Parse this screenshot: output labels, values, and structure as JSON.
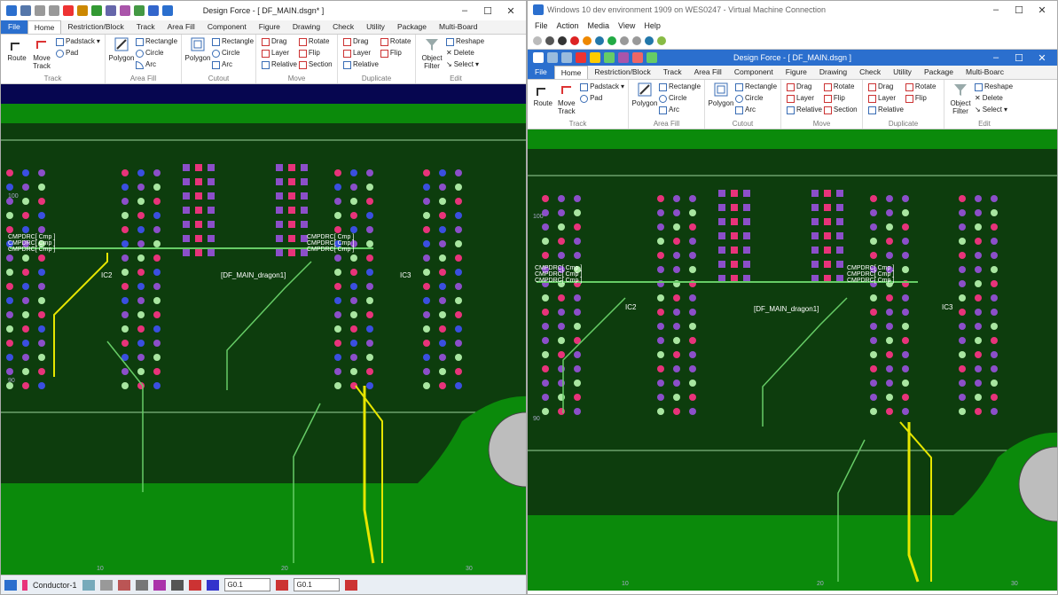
{
  "left_window": {
    "title": "Design Force - [ DF_MAIN.dsgn* ]",
    "tabs": [
      "File",
      "Home",
      "Restriction/Block",
      "Track",
      "Area Fill",
      "Component",
      "Figure",
      "Drawing",
      "Check",
      "Utility",
      "Package",
      "Multi-Board"
    ],
    "active_tab": "Home",
    "ribbon": {
      "track": {
        "label": "Track",
        "route": "Route",
        "move_track": "Move Track",
        "padstack": "Padstack",
        "pad": "Pad"
      },
      "area_fill": {
        "label": "Area Fill",
        "polygon": "Polygon",
        "rectangle": "Rectangle",
        "circle": "Circle",
        "arc": "Arc"
      },
      "cutout": {
        "label": "Cutout",
        "polygon": "Polygon",
        "rectangle": "Rectangle",
        "circle": "Circle",
        "arc": "Arc"
      },
      "move": {
        "label": "Move",
        "drag": "Drag",
        "rotate": "Rotate",
        "layer": "Layer",
        "flip": "Flip",
        "relative": "Relative",
        "section": "Section"
      },
      "duplicate": {
        "label": "Duplicate",
        "drag": "Drag",
        "rotate": "Rotate",
        "layer": "Layer",
        "flip": "Flip",
        "relative": "Relative"
      },
      "edit": {
        "label": "Edit",
        "object_filter": "Object Filter",
        "reshape": "Reshape",
        "delete": "Delete",
        "select": "Select"
      }
    },
    "canvas": {
      "label_ic2": "IC2",
      "label_ic3": "IC3",
      "label_dragon": "[DF_MAIN_dragon1]",
      "cmp_lines": [
        "CMPDRC[ Cmp ]",
        "CMPDRC[ Cmp ]",
        "CMPDRC[ Cmp ]"
      ],
      "ruler_10": "10",
      "ruler_20": "20",
      "ruler_30": "30",
      "ruler_100": "100",
      "ruler_90": "90"
    },
    "status": {
      "layer": "Conductor-1",
      "grid1": "G0.1",
      "grid2": "G0.1"
    }
  },
  "right_window": {
    "vm_title": "Windows 10 dev environment 1909 on WES0247 - Virtual Machine Connection",
    "vm_menu": [
      "File",
      "Action",
      "Media",
      "View",
      "Help"
    ],
    "app_title": "Design Force - [ DF_MAIN.dsgn ]",
    "tabs": [
      "File",
      "Home",
      "Restriction/Block",
      "Track",
      "Area Fill",
      "Component",
      "Figure",
      "Drawing",
      "Check",
      "Utility",
      "Package",
      "Multi-Boarc"
    ],
    "active_tab": "Home",
    "canvas": {
      "label_ic2": "IC2",
      "label_ic3": "IC3",
      "label_dragon": "[DF_MAIN_dragon1]",
      "cmp_lines": [
        "CMPDRC[ Cmp ]",
        "CMPDRC[ Cmp ]",
        "CMPDRC[ Cmp ]"
      ],
      "ruler_10": "10",
      "ruler_20": "20",
      "ruler_30": "30",
      "ruler_100": "100",
      "ruler_90": "90"
    }
  },
  "colors": {
    "board_dark": "#0d3d0d",
    "board_green": "#0b8a0b",
    "pad_pink": "#e8337a",
    "pad_purple": "#8b4fc9",
    "pad_blue": "#3a4fe0",
    "pad_lgreen": "#a8e6a0",
    "trace_yellow": "#e6e600",
    "accent_blue": "#2b6fce"
  }
}
